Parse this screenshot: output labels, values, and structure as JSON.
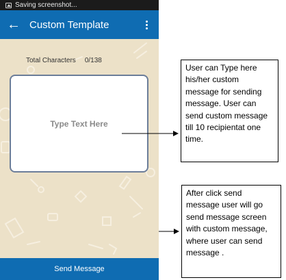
{
  "status_bar": {
    "text": "Saving screenshot...",
    "icon": "image-icon"
  },
  "app_bar": {
    "title": "Custom Template",
    "back_icon": "back-arrow-icon",
    "menu_icon": "overflow-menu-icon"
  },
  "counter": {
    "label": "Total Characters",
    "value": "0/138"
  },
  "message_input": {
    "placeholder": "Type Text Here",
    "value": ""
  },
  "send_button": {
    "label": "Send Message"
  },
  "annotations": [
    {
      "text": "User can Type here his/her custom message for sending message. User can send custom message till 10 recipientat one time."
    },
    {
      "text": "After click send message  user will go send message screen with custom message, where user can send message ."
    }
  ],
  "colors": {
    "primary": "#0f6cb2",
    "background": "#ece1c8",
    "status_bar": "#1b1b1b",
    "textbox_border": "#6b7d99"
  }
}
